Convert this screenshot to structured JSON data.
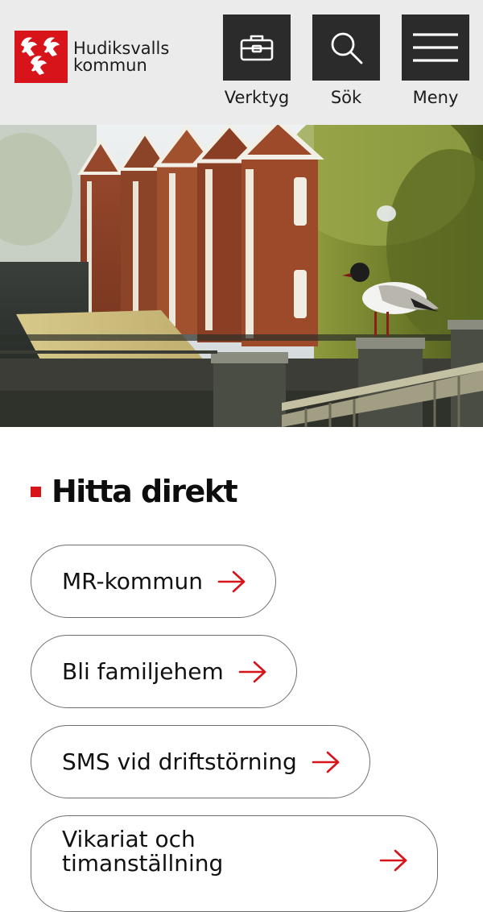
{
  "header": {
    "logo": {
      "line1": "Hudiksvalls",
      "line2": "kommun"
    },
    "tools": [
      {
        "label": "Verktyg",
        "icon": "toolbox-icon"
      },
      {
        "label": "Sök",
        "icon": "search-icon"
      },
      {
        "label": "Meny",
        "icon": "hamburger-menu-icon"
      }
    ]
  },
  "find_direct": {
    "heading": "Hitta direkt",
    "links": [
      {
        "label": "MR-kommun"
      },
      {
        "label": "Bli familjehem"
      },
      {
        "label": "SMS vid driftstörning"
      },
      {
        "label": "Vikariat och timanställning"
      }
    ]
  },
  "colors": {
    "brand_red": "#d8141b",
    "header_bg": "#ebebeb",
    "tool_bg": "#2b2b2b"
  }
}
